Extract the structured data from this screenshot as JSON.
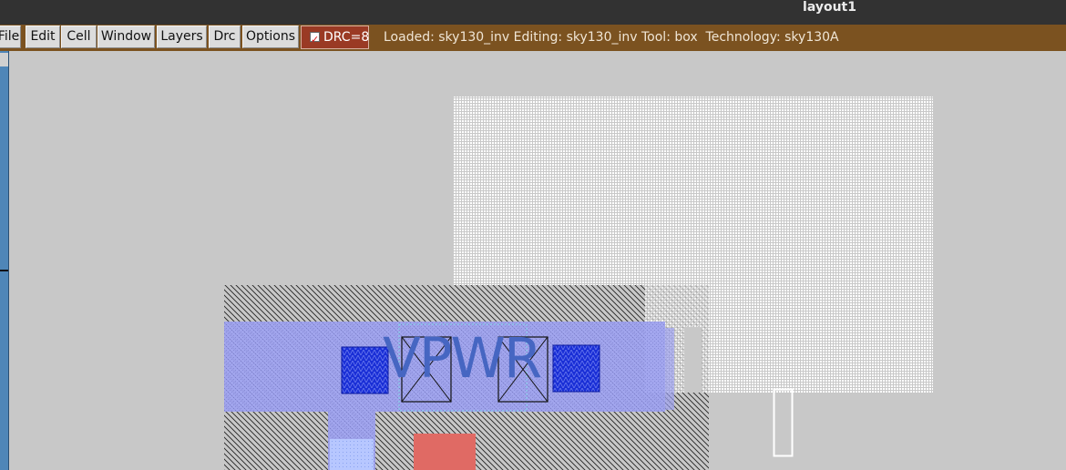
{
  "window": {
    "title": "layout1"
  },
  "menu": {
    "items": [
      "File",
      "Edit",
      "Cell",
      "Window",
      "Layers",
      "Drc",
      "Options"
    ]
  },
  "drc": {
    "checked": true,
    "label": "DRC=8"
  },
  "status": {
    "text": "Loaded: sky130_inv Editing: sky130_inv Tool: box  Technology: sky130A"
  },
  "layout": {
    "label": "VPWR"
  },
  "colors": {
    "menubar": "#7b5220",
    "drc_button": "#9a3a24",
    "metal": "#9a9cf0",
    "contact": "#1a2fd6",
    "poly": "#e06060",
    "label": "#4666c2"
  }
}
